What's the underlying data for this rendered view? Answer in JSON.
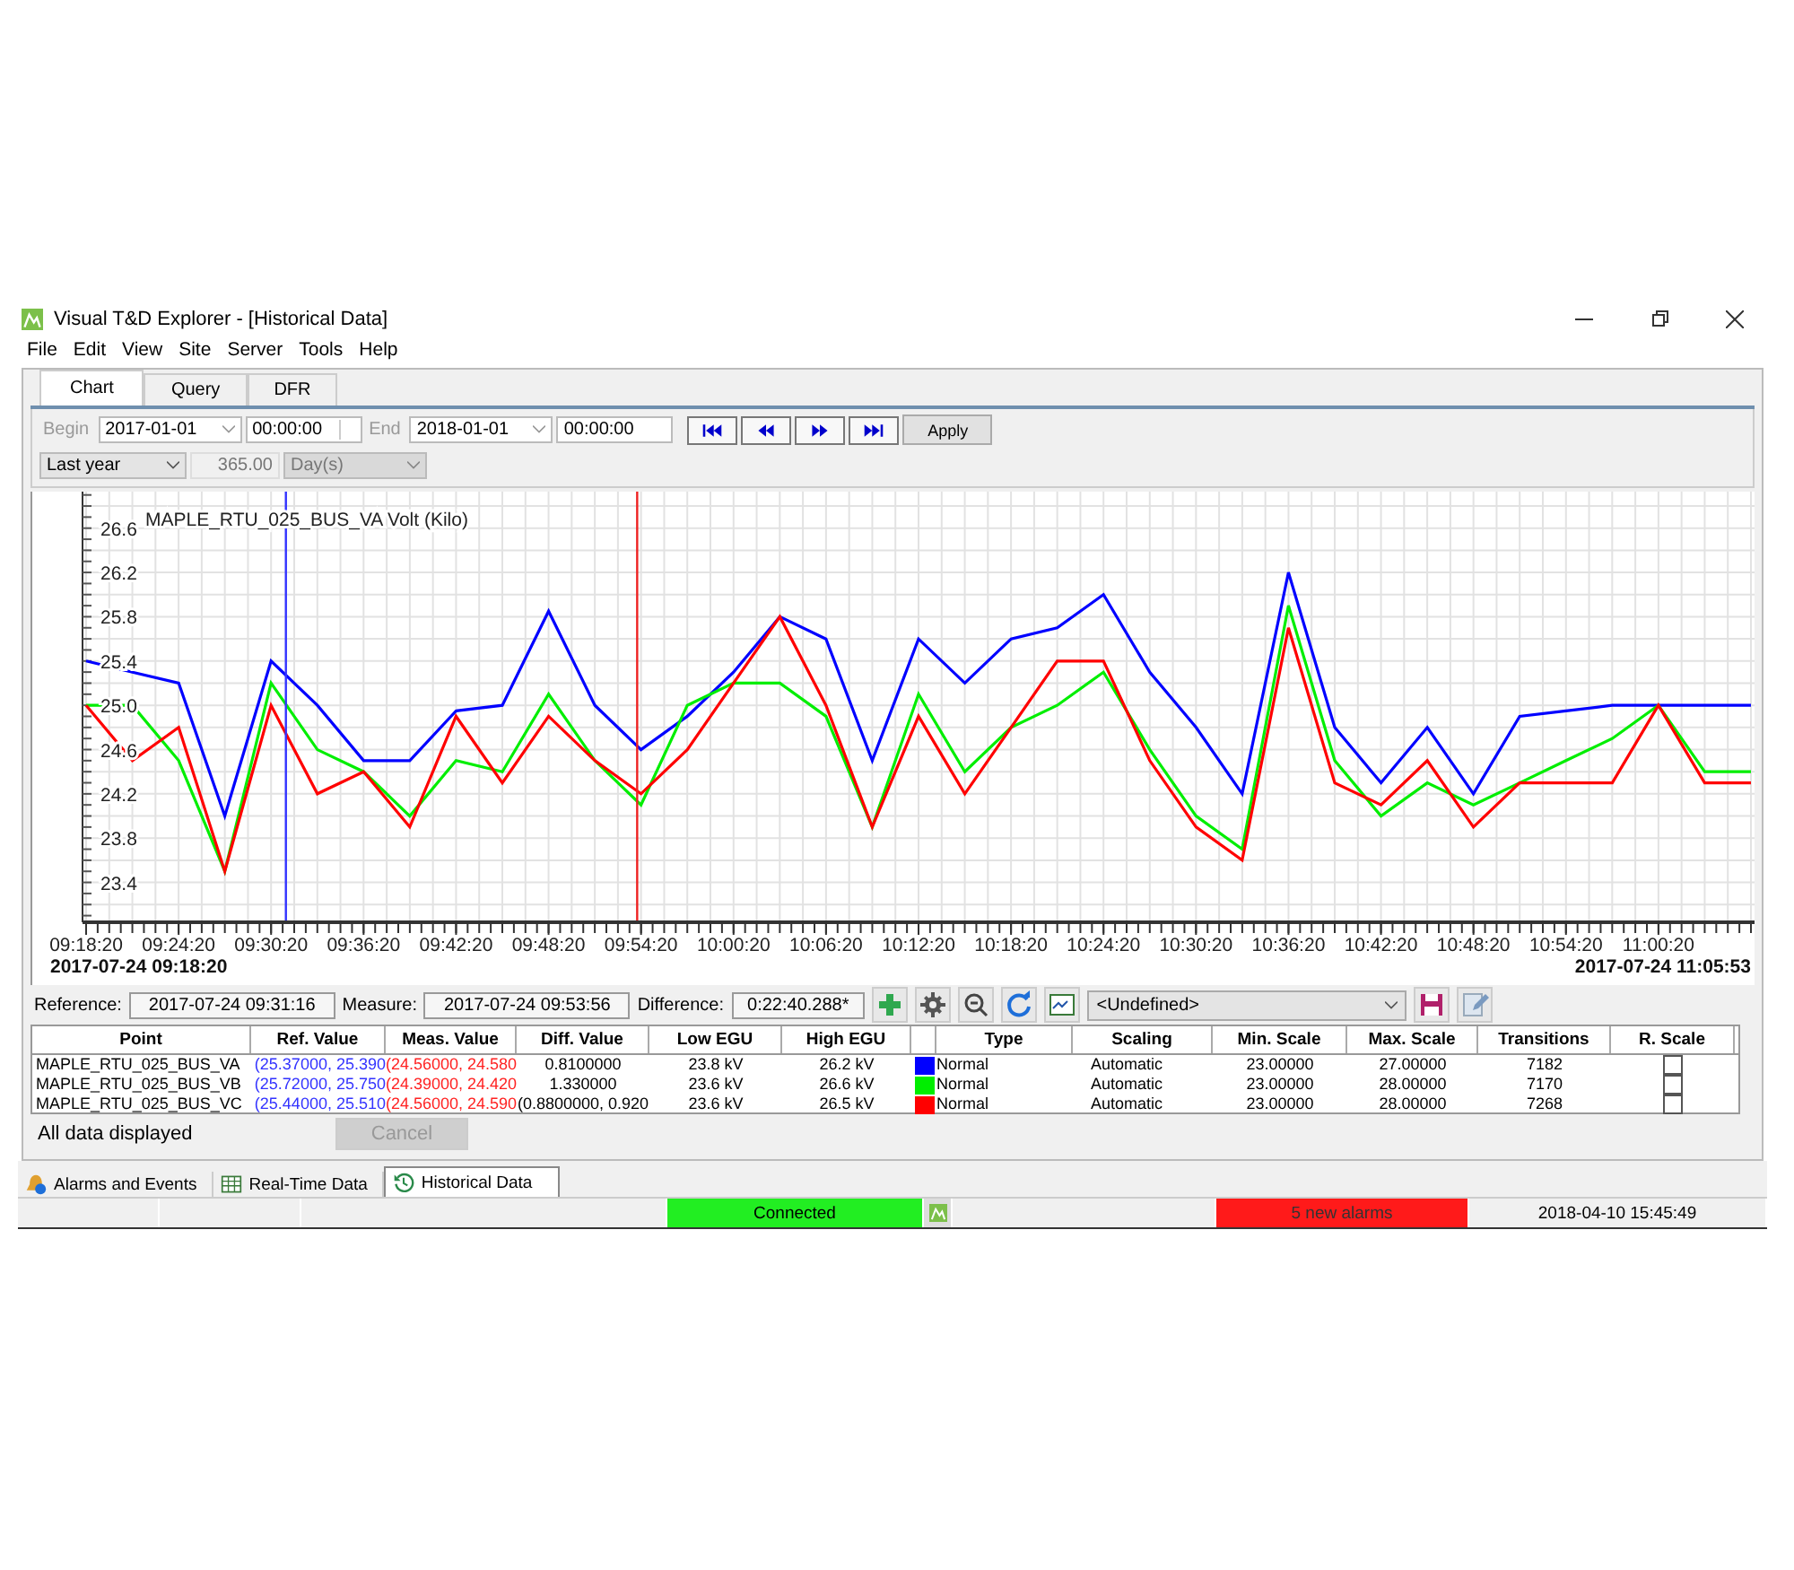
{
  "window": {
    "title": "Visual T&D Explorer - [Historical Data]"
  },
  "menu": [
    "File",
    "Edit",
    "View",
    "Site",
    "Server",
    "Tools",
    "Help"
  ],
  "tabs": [
    {
      "label": "Chart",
      "selected": true
    },
    {
      "label": "Query",
      "selected": false
    },
    {
      "label": "DFR",
      "selected": false
    }
  ],
  "time_range": {
    "begin_label": "Begin",
    "begin_date": "2017-01-01",
    "begin_time": "00:00:00",
    "end_label": "End",
    "end_date": "2018-01-01",
    "end_time": "00:00:00",
    "apply": "Apply",
    "period": "Last year",
    "count": "365.00",
    "unit": {
      "value": "Day(s)",
      "disabled": true
    }
  },
  "chart": {
    "range_start": "2017-07-24 09:18:20",
    "range_end": "2017-07-24 11:05:53",
    "chart_data": {
      "type": "line",
      "title": "MAPLE_RTU_025_BUS_VA Volt (Kilo)",
      "categories": [
        "09:18:20",
        null,
        "09:24:20",
        null,
        "09:30:20",
        null,
        "09:36:20",
        null,
        "09:42:20",
        null,
        "09:48:20",
        null,
        "09:54:20",
        null,
        "10:00:20",
        null,
        "10:06:20",
        null,
        "10:12:20",
        null,
        "10:18:20",
        null,
        "10:24:20",
        null,
        "10:30:20",
        null,
        "10:36:20",
        null,
        "10:42:20",
        null,
        "10:48:20",
        null,
        "10:54:20",
        null,
        "11:00:20",
        null,
        null
      ],
      "series": [
        {
          "color": "#0000ff",
          "values": [
            25.4,
            25.3,
            25.2,
            24.0,
            25.4,
            25.0,
            24.5,
            24.5,
            24.95,
            25.0,
            25.85,
            25.0,
            24.6,
            24.9,
            25.3,
            25.8,
            25.6,
            24.5,
            25.6,
            25.2,
            25.6,
            25.7,
            26.0,
            25.3,
            24.8,
            24.2,
            26.2,
            24.8,
            24.3,
            24.8,
            24.2,
            24.9,
            24.95,
            25.0,
            25.0,
            25.0,
            25.0
          ]
        },
        {
          "color": "#00ee00",
          "values": [
            25.0,
            25.0,
            24.5,
            23.5,
            25.2,
            24.6,
            24.4,
            24.0,
            24.5,
            24.4,
            25.1,
            24.5,
            24.1,
            25.0,
            25.2,
            25.2,
            24.9,
            23.9,
            25.1,
            24.4,
            24.8,
            25.0,
            25.3,
            24.6,
            24.0,
            23.7,
            25.9,
            24.5,
            24.0,
            24.3,
            24.1,
            24.3,
            24.5,
            24.7,
            25.0,
            24.4,
            24.4
          ]
        },
        {
          "color": "#ff0000",
          "values": [
            25.0,
            24.5,
            24.8,
            23.5,
            25.0,
            24.2,
            24.4,
            23.9,
            24.9,
            24.3,
            24.9,
            24.5,
            24.2,
            24.6,
            25.2,
            25.8,
            25.0,
            23.9,
            24.9,
            24.2,
            24.8,
            25.4,
            25.4,
            24.5,
            23.9,
            23.6,
            25.7,
            24.3,
            24.1,
            24.5,
            23.9,
            24.3,
            24.3,
            24.3,
            25.0,
            24.3,
            24.3
          ]
        }
      ],
      "ylim": [
        23.04,
        26.93
      ],
      "grid": true,
      "yticks": [
        23.4,
        23.8,
        24.2,
        24.6,
        {
          "value": 25,
          "label": "25.0"
        },
        25.4,
        25.8,
        26.2,
        26.6
      ]
    },
    "cursor_lines": [
      {
        "color": "#3333ff",
        "level": 0.12
      },
      {
        "color": "#ee2222",
        "level": 0.331
      }
    ]
  },
  "cursors": {
    "reference_label": "Reference:",
    "reference": "2017-07-24 09:31:16",
    "measure_label": "Measure:",
    "measure": "2017-07-24 09:53:56",
    "difference_label": "Difference:",
    "difference": "0:22:40.288*",
    "template": "<Undefined>"
  },
  "table": {
    "columns": [
      "Point",
      "Ref. Value",
      "Meas. Value",
      "Diff. Value",
      "Low EGU",
      "High EGU",
      "Type",
      "Scaling",
      "Min. Scale",
      "Max. Scale",
      "Transitions",
      "R. Scale"
    ],
    "rows": [
      {
        "point": "MAPLE_RTU_025_BUS_VA",
        "ref_value": "(25.37000, 25.390",
        "meas_value": "(24.56000, 24.580",
        "diff_value": "0.8100000",
        "low_egu": "23.8 kV",
        "high_egu": "26.2 kV",
        "color": "#0000ff",
        "type": "Normal",
        "scaling": "Automatic",
        "min_scale": "23.00000",
        "max_scale": "27.00000",
        "transitions": "7182",
        "r_scale": false
      },
      {
        "point": "MAPLE_RTU_025_BUS_VB",
        "ref_value": "(25.72000, 25.750",
        "meas_value": "(24.39000, 24.420",
        "diff_value": "1.330000",
        "low_egu": "23.6 kV",
        "high_egu": "26.6 kV",
        "color": "#00ee00",
        "type": "Normal",
        "scaling": "Automatic",
        "min_scale": "23.00000",
        "max_scale": "28.00000",
        "transitions": "7170",
        "r_scale": false
      },
      {
        "point": "MAPLE_RTU_025_BUS_VC",
        "ref_value": "(25.44000, 25.510",
        "meas_value": "(24.56000, 24.590",
        "diff_value": "(0.8800000, 0.920",
        "low_egu": "23.6 kV",
        "high_egu": "26.5 kV",
        "color": "#ff0000",
        "type": "Normal",
        "scaling": "Automatic",
        "min_scale": "23.00000",
        "max_scale": "28.00000",
        "transitions": "7268",
        "r_scale": false
      }
    ]
  },
  "status": {
    "message": "All data displayed",
    "cancel": {
      "label": "Cancel",
      "disabled": true
    }
  },
  "bottom_tabs": [
    {
      "label": "Alarms and Events",
      "selected": false
    },
    {
      "label": "Real-Time Data",
      "selected": false
    },
    {
      "label": "Historical Data",
      "selected": true
    }
  ],
  "status_bar": {
    "connection": "Connected",
    "alarms": "5 new alarms",
    "datetime": "2018-04-10 15:45:49"
  }
}
